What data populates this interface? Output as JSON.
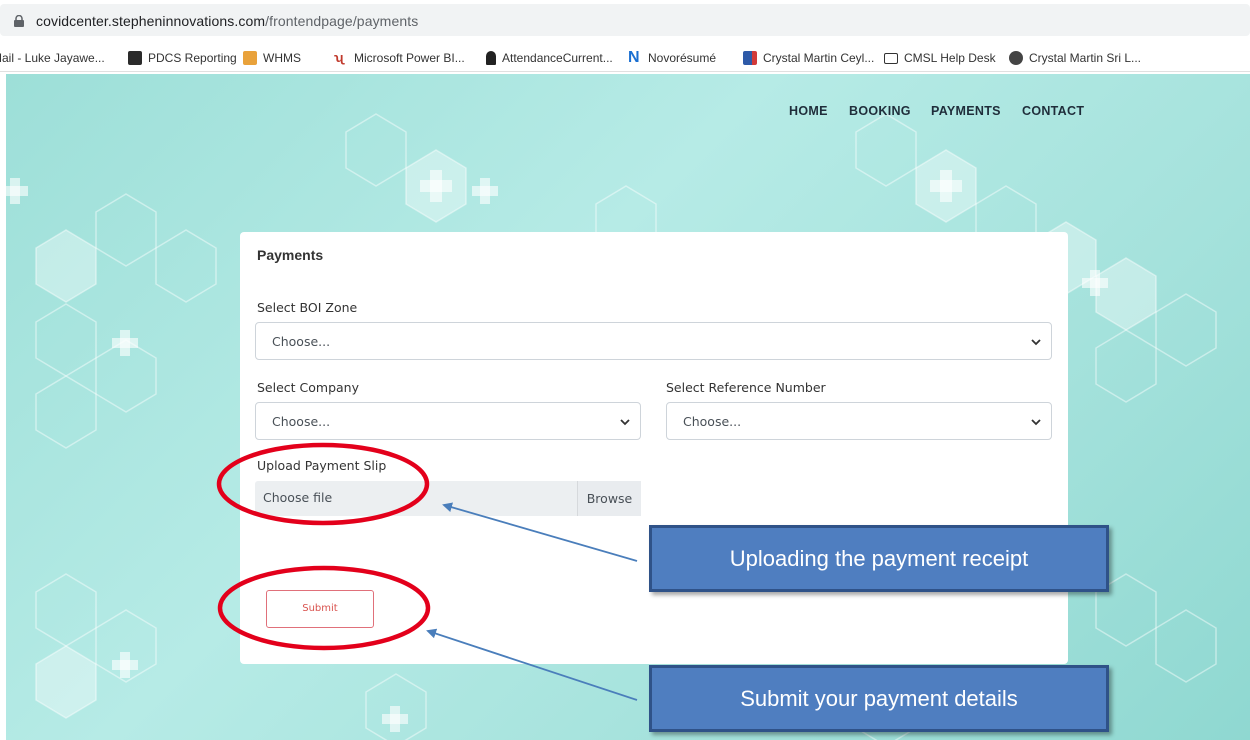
{
  "browser": {
    "url_host": "covidcenter.stepheninnovations.com",
    "url_path": "/frontendpage/payments",
    "bookmarks": [
      {
        "label": "Mail - Luke Jayawe...",
        "icon": "mail-icon"
      },
      {
        "label": "PDCS Reporting",
        "icon": "chart-icon"
      },
      {
        "label": "WHMS",
        "icon": "building-icon"
      },
      {
        "label": "Microsoft Power BI...",
        "icon": "powerbi-icon"
      },
      {
        "label": "AttendanceCurrent...",
        "icon": "person-icon"
      },
      {
        "label": "Novorésumé",
        "icon": "novoresume-icon"
      },
      {
        "label": "Crystal Martin Ceyl...",
        "icon": "crystal-martin-icon"
      },
      {
        "label": "CMSL Help Desk",
        "icon": "helpdesk-icon"
      },
      {
        "label": "Crystal Martin Sri L...",
        "icon": "globe-icon"
      }
    ]
  },
  "nav": {
    "items": [
      "HOME",
      "BOOKING",
      "PAYMENTS",
      "CONTACT"
    ]
  },
  "form": {
    "title": "Payments",
    "boi_zone": {
      "label": "Select BOI Zone",
      "value": "Choose..."
    },
    "company": {
      "label": "Select Company",
      "value": "Choose..."
    },
    "reference": {
      "label": "Select Reference Number",
      "value": "Choose..."
    },
    "upload": {
      "label": "Upload Payment Slip",
      "value": "Choose file",
      "button": "Browse"
    },
    "submit_label": "Submit"
  },
  "annotations": {
    "upload_callout": "Uploading the payment receipt",
    "submit_callout": "Submit your payment details"
  },
  "colors": {
    "page_background": "#9ddfd8",
    "callout_fill": "#4f7ec0",
    "highlight_ellipse": "#e3001b",
    "arrow": "#4a7ebb",
    "submit_text": "#d9534f"
  }
}
